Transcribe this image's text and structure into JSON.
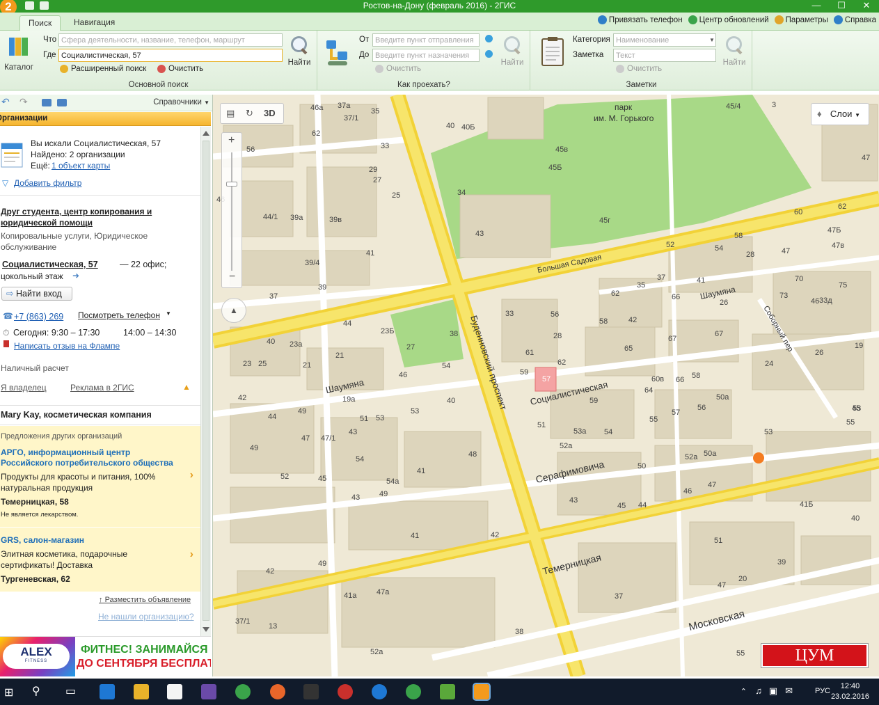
{
  "window": {
    "title": "Ростов-на-Дону (февраль 2016) - 2ГИС",
    "logo": "2"
  },
  "tabs": [
    {
      "label": "Поиск",
      "active": true
    },
    {
      "label": "Навигация",
      "active": false
    }
  ],
  "toplinks": [
    "Привязать телефон",
    "Центр обновлений",
    "Параметры",
    "Справка"
  ],
  "search": {
    "catalog_label": "Каталог",
    "what_label": "Что",
    "what_placeholder": "Сфера деятельности, название, телефон, маршрут",
    "where_label": "Где",
    "where_value": "Социалистическая, 57",
    "find_label": "Найти",
    "advanced_label": "Расширенный поиск",
    "clear_label": "Очистить",
    "group_label": "Основной поиск"
  },
  "route": {
    "from_label": "От",
    "from_placeholder": "Введите пункт отправления",
    "to_label": "До",
    "to_placeholder": "Введите пункт назначения",
    "clear_label": "Очистить",
    "find_label": "Найти",
    "group_label": "Как проехать?"
  },
  "notes": {
    "category_label": "Категория",
    "category_placeholder": "Наименование",
    "note_label": "Заметка",
    "note_placeholder": "Текст",
    "clear_label": "Очистить",
    "find_label": "Найти",
    "group_label": "Заметки"
  },
  "left": {
    "reference_label": "Справочники",
    "header": "Организации",
    "summary": {
      "searched": "Вы искали Социалистическая, 57",
      "found": "Найдено: 2 организации",
      "more_prefix": "Ещё:",
      "more_link": "1 объект карты"
    },
    "add_filter": "Добавить фильтр",
    "org1": {
      "name_line1": "Друг студента, центр копирования и",
      "name_line2": "юридической помощи",
      "cat_line1": "Копировальные услуги, Юридическое",
      "cat_line2": "обслуживание",
      "address_link": "Социалистическая, 57",
      "address_rest": "— 22 офис;",
      "floor": "цокольный этаж",
      "find_entrance": "Найти вход",
      "phone": "+7 (863) 269",
      "show_phone": "Посмотреть телефон",
      "hours": "Сегодня: 9:30 – 17:30",
      "hours2": "14:00 – 14:30",
      "review": "Написать отзыв на Флампе",
      "payment": "Наличный расчет",
      "owner": "Я владелец",
      "ad_link": "Реклама в 2ГИС"
    },
    "org2": {
      "name": "Mary Kay, косметическая компания"
    },
    "offers_title": "Предложения других организаций",
    "promo1": {
      "name_line1": "АРГО, информационный центр",
      "name_line2": "Российского потребительского общества",
      "desc_line1": "Продукты для красоты и питания, 100%",
      "desc_line2": "натуральная продукция",
      "address": "Темерницкая, 58",
      "note": "Не является лекарством."
    },
    "promo2": {
      "name": "GRS, салон-магазин",
      "desc_line1": "Элитная косметика, подарочные",
      "desc_line2": "сертификаты! Доставка",
      "address": "Тургеневская, 62"
    },
    "place_ad": "Разместить объявление",
    "not_found": "Не нашли организацию?",
    "banner": {
      "brand": "ALEX",
      "brand_sub": "FITNESS",
      "line1": "ФИТНЕС! ЗАНИМАЙСЯ",
      "line2": "ДО СЕНТЯБРЯ БЕСПЛАТНО!"
    }
  },
  "map": {
    "btn_3d": "3D",
    "layers": "Слои",
    "store_badge": "ЦУМ",
    "park_line1": "парк",
    "park_line2": "им. М. Горького",
    "streets": {
      "budennovsky": "Буденновский проспект",
      "sotsialisticheskaya": "Социалистическая",
      "bolshaya_sadovaya": "Большая Садовая",
      "shaumyana_left": "Шаумяна",
      "shaumyana_right": "Шаумяна",
      "serafimovicha": "Серафимовича",
      "temernitskaya": "Темерницкая",
      "moskovskaya": "Московская",
      "sobornyi": "Соборный пер"
    },
    "target": "57",
    "house_numbers": [
      {
        "n": "46а"
      },
      {
        "n": "37а"
      },
      {
        "n": "35"
      },
      {
        "n": "37/1"
      },
      {
        "n": "62"
      },
      {
        "n": "33"
      },
      {
        "n": "56"
      },
      {
        "n": "29"
      },
      {
        "n": "27"
      },
      {
        "n": "25"
      },
      {
        "n": "46"
      },
      {
        "n": "44/1"
      },
      {
        "n": "39а"
      },
      {
        "n": "39в"
      },
      {
        "n": "41"
      },
      {
        "n": "39/4"
      },
      {
        "n": "39"
      },
      {
        "n": "37"
      },
      {
        "n": "34"
      },
      {
        "n": "43"
      },
      {
        "n": "40"
      },
      {
        "n": "40Б"
      },
      {
        "n": "45в"
      },
      {
        "n": "45Б"
      },
      {
        "n": "45г"
      },
      {
        "n": "45/4"
      },
      {
        "n": "3"
      },
      {
        "n": "47"
      },
      {
        "n": "60"
      },
      {
        "n": "62"
      },
      {
        "n": "47Б"
      },
      {
        "n": "58"
      },
      {
        "n": "28"
      },
      {
        "n": "47в"
      },
      {
        "n": "52"
      },
      {
        "n": "54"
      },
      {
        "n": "47"
      },
      {
        "n": "35"
      },
      {
        "n": "37"
      },
      {
        "n": "41"
      },
      {
        "n": "70"
      },
      {
        "n": "75"
      },
      {
        "n": "33д"
      },
      {
        "n": "62"
      },
      {
        "n": "66"
      },
      {
        "n": "26"
      },
      {
        "n": "73"
      },
      {
        "n": "46"
      },
      {
        "n": "33"
      },
      {
        "n": "56"
      },
      {
        "n": "58"
      },
      {
        "n": "42"
      },
      {
        "n": "44"
      },
      {
        "n": "23Б"
      },
      {
        "n": "38"
      },
      {
        "n": "40"
      },
      {
        "n": "23а"
      },
      {
        "n": "27"
      },
      {
        "n": "21"
      },
      {
        "n": "23"
      },
      {
        "n": "25"
      },
      {
        "n": "21"
      },
      {
        "n": "54"
      },
      {
        "n": "28"
      },
      {
        "n": "61"
      },
      {
        "n": "65"
      },
      {
        "n": "67"
      },
      {
        "n": "67"
      },
      {
        "n": "19"
      },
      {
        "n": "24"
      },
      {
        "n": "26"
      },
      {
        "n": "59"
      },
      {
        "n": "62"
      },
      {
        "n": "60в"
      },
      {
        "n": "64"
      },
      {
        "n": "66"
      },
      {
        "n": "58"
      },
      {
        "n": "59"
      },
      {
        "n": "50а"
      },
      {
        "n": "46"
      },
      {
        "n": "19а"
      },
      {
        "n": "40"
      },
      {
        "n": "42"
      },
      {
        "n": "44"
      },
      {
        "n": "49"
      },
      {
        "n": "51"
      },
      {
        "n": "53"
      },
      {
        "n": "53"
      },
      {
        "n": "55"
      },
      {
        "n": "57"
      },
      {
        "n": "56"
      },
      {
        "n": "51"
      },
      {
        "n": "53а"
      },
      {
        "n": "54"
      },
      {
        "n": "53"
      },
      {
        "n": "55"
      },
      {
        "n": "45"
      },
      {
        "n": "47"
      },
      {
        "n": "47/1"
      },
      {
        "n": "43"
      },
      {
        "n": "49"
      },
      {
        "n": "52а"
      },
      {
        "n": "54"
      },
      {
        "n": "48"
      },
      {
        "n": "50"
      },
      {
        "n": "52а"
      },
      {
        "n": "50а"
      },
      {
        "n": "52"
      },
      {
        "n": "45"
      },
      {
        "n": "54а"
      },
      {
        "n": "41"
      },
      {
        "n": "43"
      },
      {
        "n": "49"
      },
      {
        "n": "47"
      },
      {
        "n": "46"
      },
      {
        "n": "43"
      },
      {
        "n": "45"
      },
      {
        "n": "44"
      },
      {
        "n": "41Б"
      },
      {
        "n": "41"
      },
      {
        "n": "42"
      },
      {
        "n": "51"
      },
      {
        "n": "40"
      },
      {
        "n": "42"
      },
      {
        "n": "49"
      },
      {
        "n": "39"
      },
      {
        "n": "41а"
      },
      {
        "n": "47а"
      },
      {
        "n": "47"
      },
      {
        "n": "20"
      },
      {
        "n": "37"
      },
      {
        "n": "37/1"
      },
      {
        "n": "13"
      },
      {
        "n": "38"
      },
      {
        "n": "52а"
      },
      {
        "n": "55"
      },
      {
        "n": "53"
      }
    ]
  },
  "taskbar": {
    "lang": "РУС",
    "time": "12:40",
    "date": "23.02.2016"
  },
  "colors": {
    "titlebar": "#2f9a2b",
    "ribbon": "#e6f3e3",
    "road_major": "#f7e15a",
    "road_minor": "#ffffff",
    "block": "#efe9d6",
    "building": "#ddd5bc",
    "park": "#a8d987",
    "accent": "#f47c20",
    "link": "#1f5fb3"
  }
}
